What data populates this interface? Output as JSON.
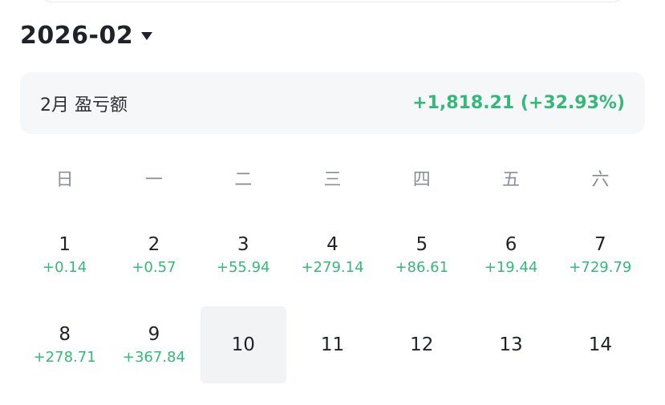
{
  "header": {
    "month": "2026-02"
  },
  "summary": {
    "label": "2月 盈亏额",
    "value": "+1,818.21 (+32.93%)"
  },
  "colors": {
    "profit": "#35b87a",
    "today_bg": "#f2f3f5",
    "card_bg": "#f6f7f9"
  },
  "weekdays": [
    "日",
    "一",
    "二",
    "三",
    "四",
    "五",
    "六"
  ],
  "days": [
    {
      "day": "1",
      "pnl": "+0.14"
    },
    {
      "day": "2",
      "pnl": "+0.57"
    },
    {
      "day": "3",
      "pnl": "+55.94"
    },
    {
      "day": "4",
      "pnl": "+279.14"
    },
    {
      "day": "5",
      "pnl": "+86.61"
    },
    {
      "day": "6",
      "pnl": "+19.44"
    },
    {
      "day": "7",
      "pnl": "+729.79"
    },
    {
      "day": "8",
      "pnl": "+278.71"
    },
    {
      "day": "9",
      "pnl": "+367.84"
    },
    {
      "day": "10",
      "pnl": "",
      "today": true
    },
    {
      "day": "11",
      "pnl": ""
    },
    {
      "day": "12",
      "pnl": ""
    },
    {
      "day": "13",
      "pnl": ""
    },
    {
      "day": "14",
      "pnl": ""
    }
  ]
}
